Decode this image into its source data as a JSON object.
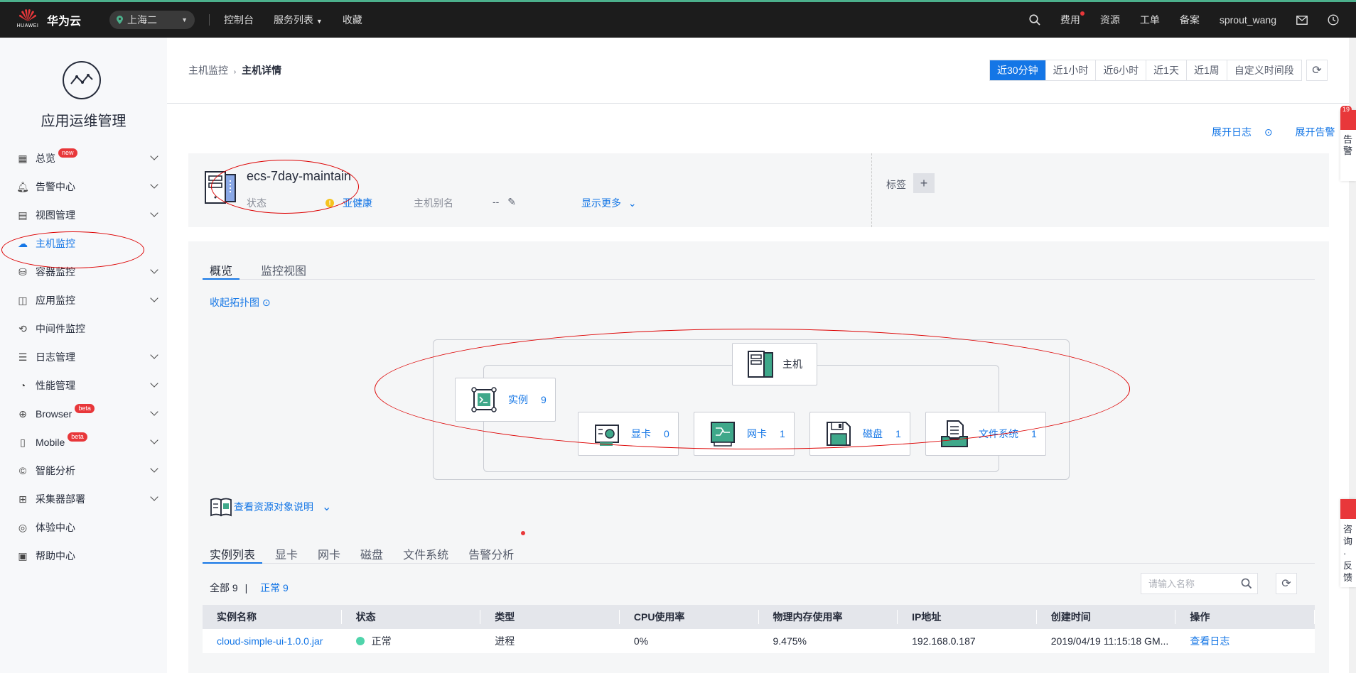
{
  "topbar": {
    "brand": "华为云",
    "brand_small": "HUAWEI",
    "region": "上海二",
    "nav": [
      "控制台",
      "服务列表",
      "收藏"
    ],
    "right": [
      "费用",
      "资源",
      "工单",
      "备案"
    ],
    "user": "sprout_wang"
  },
  "sidebar": {
    "title": "应用运维管理",
    "items": [
      {
        "label": "总览",
        "badge": "new",
        "icon": "dashboard-icon",
        "chevron": true
      },
      {
        "label": "告警中心",
        "icon": "bell-icon",
        "chevron": true
      },
      {
        "label": "视图管理",
        "icon": "view-icon",
        "chevron": true
      },
      {
        "label": "主机监控",
        "icon": "host-icon",
        "chevron": false,
        "active": true
      },
      {
        "label": "容器监控",
        "icon": "container-icon",
        "chevron": true
      },
      {
        "label": "应用监控",
        "icon": "app-icon",
        "chevron": true
      },
      {
        "label": "中间件监控",
        "icon": "middleware-icon",
        "chevron": false
      },
      {
        "label": "日志管理",
        "icon": "log-icon",
        "chevron": true
      },
      {
        "label": "性能管理",
        "icon": "performance-icon",
        "chevron": true
      },
      {
        "label": "Browser",
        "badge": "beta",
        "icon": "globe-icon",
        "chevron": true
      },
      {
        "label": "Mobile",
        "badge": "beta",
        "icon": "mobile-icon",
        "chevron": true
      },
      {
        "label": "智能分析",
        "icon": "analysis-icon",
        "chevron": true
      },
      {
        "label": "采集器部署",
        "icon": "collector-icon",
        "chevron": true
      },
      {
        "label": "体验中心",
        "icon": "experience-icon",
        "chevron": false
      },
      {
        "label": "帮助中心",
        "icon": "help-icon",
        "chevron": false
      }
    ]
  },
  "breadcrumb": {
    "parent": "主机监控",
    "current": "主机详情"
  },
  "time_tabs": [
    "近30分钟",
    "近1小时",
    "近6小时",
    "近1天",
    "近1周",
    "自定义时间段"
  ],
  "time_selected": "近30分钟",
  "expand": {
    "logs": "展开日志",
    "alerts": "展开告警"
  },
  "host": {
    "name": "ecs-7day-maintain",
    "status_label": "状态",
    "status": "亚健康",
    "alias_label": "主机别名",
    "alias": "--",
    "show_more": "显示更多",
    "tag_label": "标签"
  },
  "overview_tabs": [
    "概览",
    "监控视图"
  ],
  "collapse_topo": "收起拓扑图",
  "topology": {
    "host": "主机",
    "instance": {
      "label": "实例",
      "count": "9"
    },
    "gpu": {
      "label": "显卡",
      "count": "0"
    },
    "nic": {
      "label": "网卡",
      "count": "1"
    },
    "disk": {
      "label": "磁盘",
      "count": "1"
    },
    "fs": {
      "label": "文件系统",
      "count": "1"
    }
  },
  "view_desc": "查看资源对象说明",
  "list_tabs": [
    "实例列表",
    "显卡",
    "网卡",
    "磁盘",
    "文件系统",
    "告警分析"
  ],
  "counts": {
    "all": "全部 9",
    "sep": "|",
    "normal": "正常 9"
  },
  "search": {
    "placeholder": "请输入名称"
  },
  "table": {
    "headers": [
      "实例名称",
      "状态",
      "类型",
      "CPU使用率",
      "物理内存使用率",
      "IP地址",
      "创建时间",
      "操作"
    ],
    "rows": [
      [
        "cloud-simple-ui-1.0.0.jar",
        "正常",
        "进程",
        "0%",
        "9.475%",
        "192.168.0.187",
        "2019/04/19 11:15:18 GM...",
        "查看日志"
      ]
    ]
  },
  "float": {
    "alert_count": "19",
    "alert_text": "告警",
    "help_text": "咨询·反馈"
  }
}
